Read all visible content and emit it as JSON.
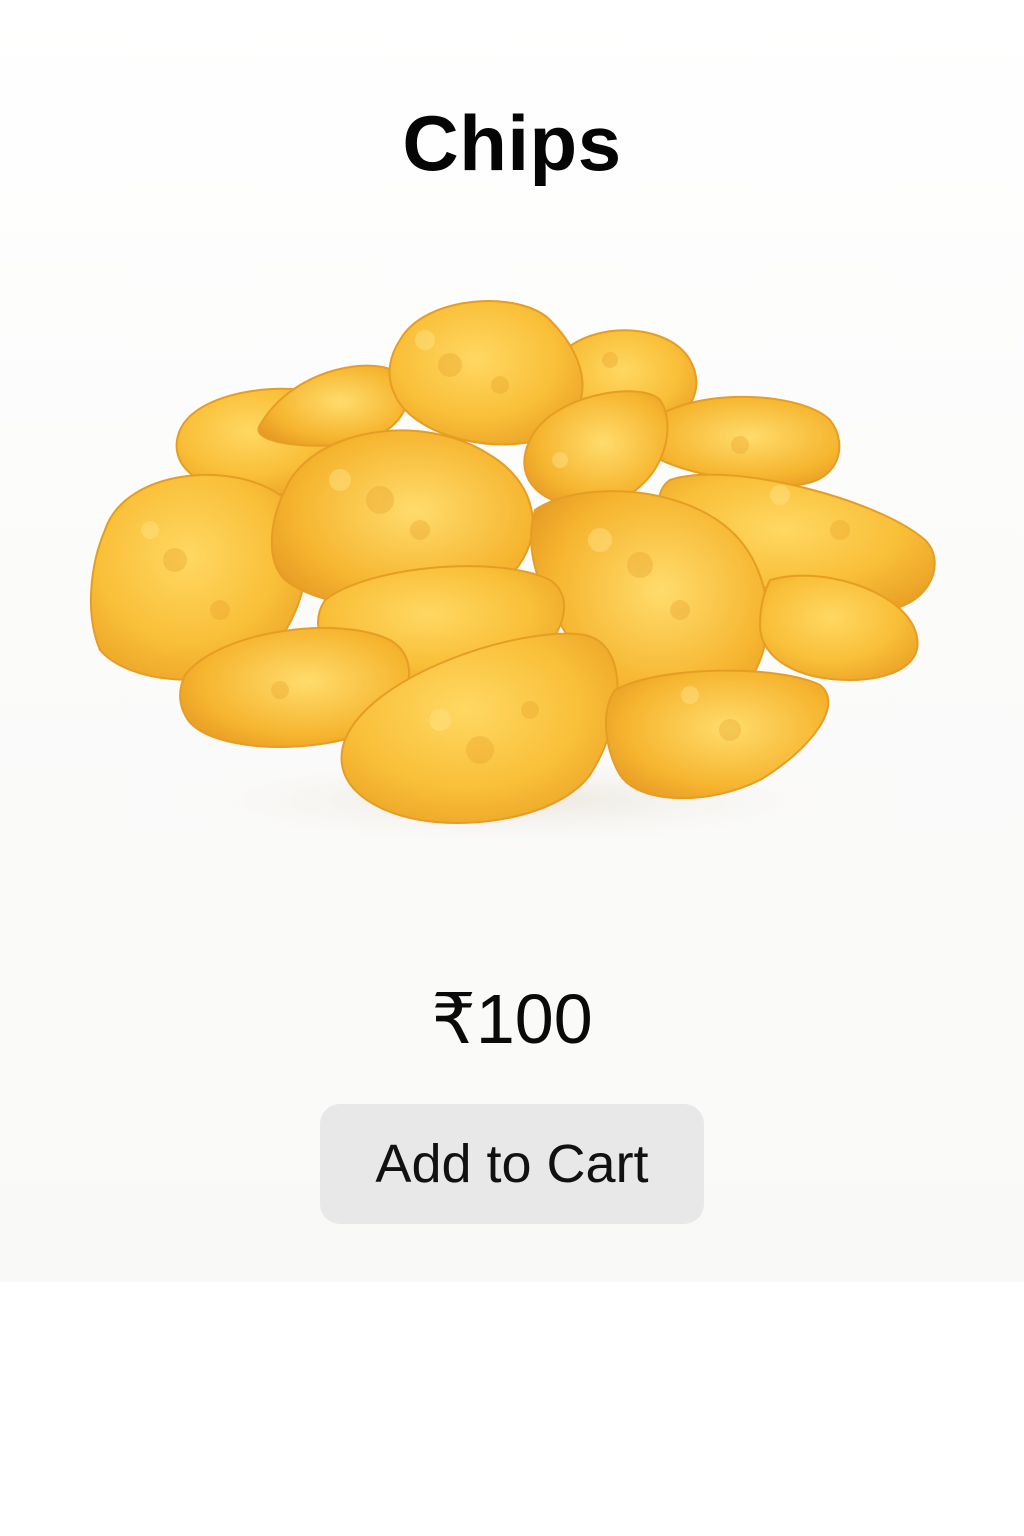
{
  "product": {
    "title": "Chips",
    "image_icon": "potato-chips-pile",
    "price": "₹100",
    "add_to_cart_label": "Add to Cart"
  },
  "colors": {
    "button_background": "#e8e8e8",
    "chip_base": "#f7b733",
    "chip_light": "#ffd45a",
    "chip_dark": "#e89a1f"
  }
}
